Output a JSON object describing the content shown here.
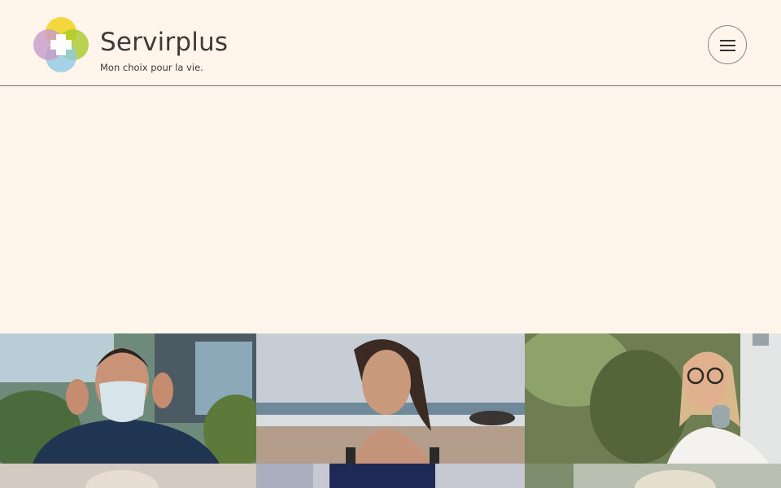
{
  "brand": {
    "name": "Servirplus",
    "tagline": "Mon choix pour la vie.",
    "colors": [
      "#f2d21c",
      "#a8c92a",
      "#8fc9e3",
      "#c79bc9"
    ]
  },
  "header": {
    "menu_icon": "hamburger-menu-icon"
  },
  "photo_grid": {
    "tiles": [
      {
        "subject": "man-with-mask-photo"
      },
      {
        "subject": "woman-at-beach-photo"
      },
      {
        "subject": "man-with-glasses-photo"
      },
      {
        "subject": "elderly-person-photo"
      },
      {
        "subject": "woman-floral-top-photo"
      },
      {
        "subject": "person-with-hat-photo"
      }
    ]
  }
}
